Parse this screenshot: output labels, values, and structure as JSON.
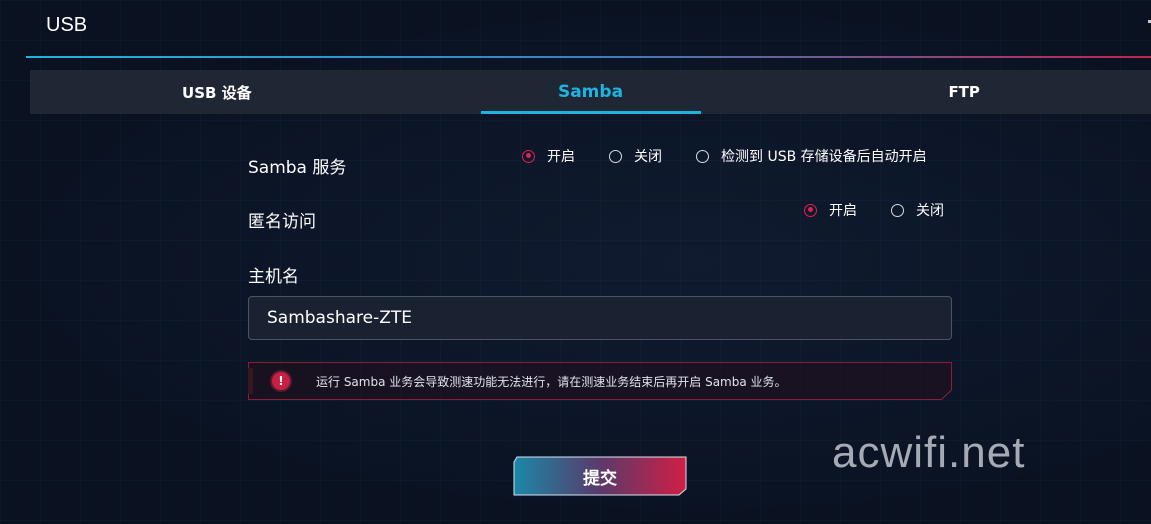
{
  "page": {
    "title": "USB"
  },
  "tabs": [
    {
      "label": "USB 设备",
      "active": false
    },
    {
      "label": "Samba",
      "active": true
    },
    {
      "label": "FTP",
      "active": false
    }
  ],
  "samba_service": {
    "label": "Samba 服务",
    "options": [
      "开启",
      "关闭",
      "检测到 USB 存储设备后自动开启"
    ],
    "selected": "开启"
  },
  "anonymous_access": {
    "label": "匿名访问",
    "options": [
      "开启",
      "关闭"
    ],
    "selected": "开启"
  },
  "hostname": {
    "label": "主机名",
    "value": "Sambashare-ZTE"
  },
  "warning": {
    "icon": "exclamation-icon",
    "text": "运行 Samba 业务会导致测速功能无法进行，请在测速业务结束后再开启 Samba 业务。"
  },
  "submit": {
    "label": "提交"
  },
  "watermark": "acwifi.net",
  "colors": {
    "accent_cyan": "#1fb4e0",
    "accent_red": "#e0214f",
    "background": "#0b1324"
  }
}
